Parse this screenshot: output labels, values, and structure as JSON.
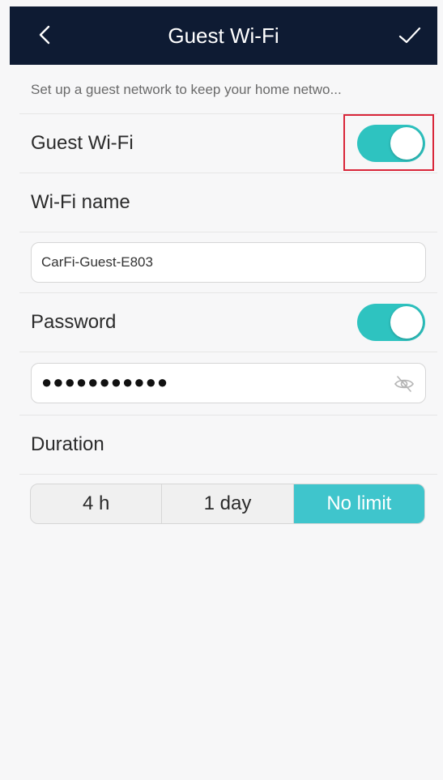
{
  "header": {
    "back_icon": "chevron-left-icon",
    "title": "Guest Wi-Fi",
    "confirm_icon": "checkmark-icon"
  },
  "description": "Set up a guest network to keep your home netwo...",
  "guest_wifi": {
    "label": "Guest Wi-Fi",
    "enabled": true
  },
  "wifi_name": {
    "label": "Wi-Fi name",
    "value": "CarFi-Guest-E803"
  },
  "password": {
    "label": "Password",
    "enabled": true,
    "masked_value": "●●●●●●●●●●●",
    "visibility_icon": "eye-hidden-icon"
  },
  "duration": {
    "label": "Duration",
    "options": [
      "4 h",
      "1 day",
      "No limit"
    ],
    "selected": "No limit"
  },
  "colors": {
    "header_bg": "#0e1b33",
    "toggle_on": "#2ec3c0",
    "segment_active": "#3fc5cc",
    "highlight_border": "#d9263a"
  }
}
